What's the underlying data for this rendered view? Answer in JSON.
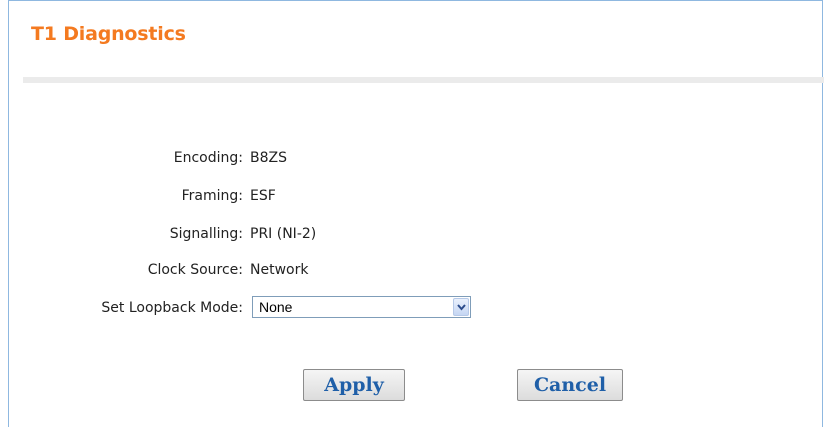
{
  "page": {
    "title": "T1 Diagnostics"
  },
  "fields": {
    "encoding": {
      "label": "Encoding:",
      "value": "B8ZS"
    },
    "framing": {
      "label": "Framing:",
      "value": "ESF"
    },
    "signalling": {
      "label": "Signalling:",
      "value": "PRI (NI-2)"
    },
    "clock_source": {
      "label": "Clock Source:",
      "value": "Network"
    },
    "loopback": {
      "label": "Set Loopback Mode:",
      "selected": "None"
    }
  },
  "buttons": {
    "apply": "Apply",
    "cancel": "Cancel"
  },
  "colors": {
    "title": "#f47a20",
    "button_text": "#1f5fa8",
    "panel_border": "#8fb8e0"
  },
  "icons": {
    "dropdown": "chevron-down-icon"
  }
}
